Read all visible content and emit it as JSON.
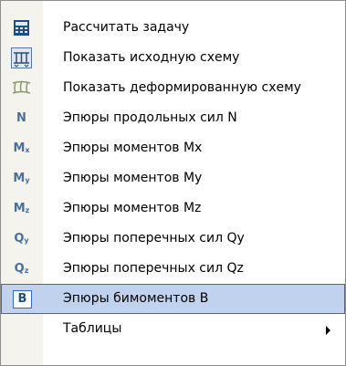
{
  "menu": {
    "items": [
      {
        "label": "Рассчитать задачу",
        "icon": "calculator-icon"
      },
      {
        "label": "Показать исходную схему",
        "icon": "initial-scheme-icon"
      },
      {
        "label": "Показать деформированную схему",
        "icon": "deformed-scheme-icon"
      },
      {
        "label": "Эпюры продольных сил N",
        "icon": "letter-n-icon",
        "glyph": "N"
      },
      {
        "label": "Эпюры моментов Mx",
        "icon": "letter-mx-icon",
        "glyph": "M",
        "sub": "x"
      },
      {
        "label": "Эпюры моментов My",
        "icon": "letter-my-icon",
        "glyph": "M",
        "sub": "y"
      },
      {
        "label": "Эпюры моментов Mz",
        "icon": "letter-mz-icon",
        "glyph": "M",
        "sub": "z"
      },
      {
        "label": "Эпюры поперечных сил Qy",
        "icon": "letter-qy-icon",
        "glyph": "Q",
        "sub": "y"
      },
      {
        "label": "Эпюры поперечных сил Qz",
        "icon": "letter-qz-icon",
        "glyph": "Q",
        "sub": "z"
      },
      {
        "label": "Эпюры бимоментов B",
        "icon": "letter-b-icon",
        "glyph": "B",
        "selected": true
      },
      {
        "label": "Таблицы",
        "submenu": true
      }
    ]
  },
  "colors": {
    "highlight": "#c1d2ee",
    "highlight_border": "#316ac5",
    "icon_text": "#4a6f9a"
  }
}
